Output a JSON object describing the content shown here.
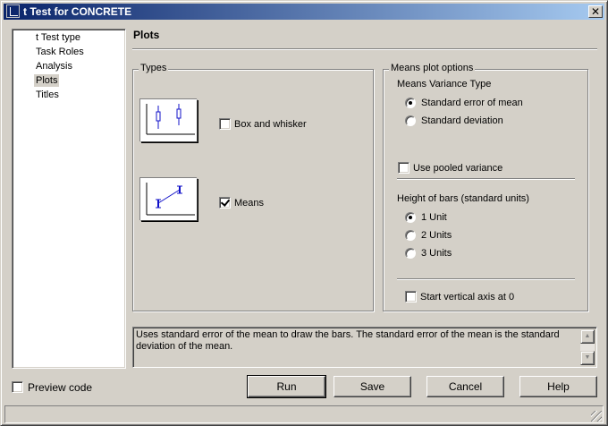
{
  "window": {
    "title": "t Test for CONCRETE",
    "close_symbol": "✕"
  },
  "nav": {
    "items": [
      {
        "label": "t Test type",
        "selected": false
      },
      {
        "label": "Task Roles",
        "selected": false
      },
      {
        "label": "Analysis",
        "selected": false
      },
      {
        "label": "Plots",
        "selected": true
      },
      {
        "label": "Titles",
        "selected": false
      }
    ]
  },
  "pane": {
    "title": "Plots"
  },
  "types": {
    "legend": "Types",
    "box_whisker": {
      "label": "Box and whisker",
      "checked": false
    },
    "means": {
      "label": "Means",
      "checked": true
    }
  },
  "means_options": {
    "legend": "Means plot options",
    "variance_type_label": "Means Variance Type",
    "variance_options": [
      {
        "label": "Standard error of mean",
        "selected": true
      },
      {
        "label": "Standard deviation",
        "selected": false
      }
    ],
    "pooled": {
      "label": "Use pooled variance",
      "checked": false
    },
    "height_label": "Height of bars (standard units)",
    "height_options": [
      {
        "label": "1 Unit",
        "selected": true
      },
      {
        "label": "2 Units",
        "selected": false
      },
      {
        "label": "3 Units",
        "selected": false
      }
    ],
    "start_axis": {
      "label": "Start vertical axis at 0",
      "checked": false
    }
  },
  "description": "Uses standard error of the mean to draw the bars. The standard error of the mean is the standard deviation of the mean.",
  "preview_code": {
    "label": "Preview code",
    "checked": false
  },
  "buttons": {
    "run": "Run",
    "save": "Save",
    "cancel": "Cancel",
    "help": "Help"
  },
  "colors": {
    "title_start": "#0a246a",
    "title_end": "#a6caf0",
    "chart_blue": "#1010c8",
    "face": "#d4d0c8"
  }
}
